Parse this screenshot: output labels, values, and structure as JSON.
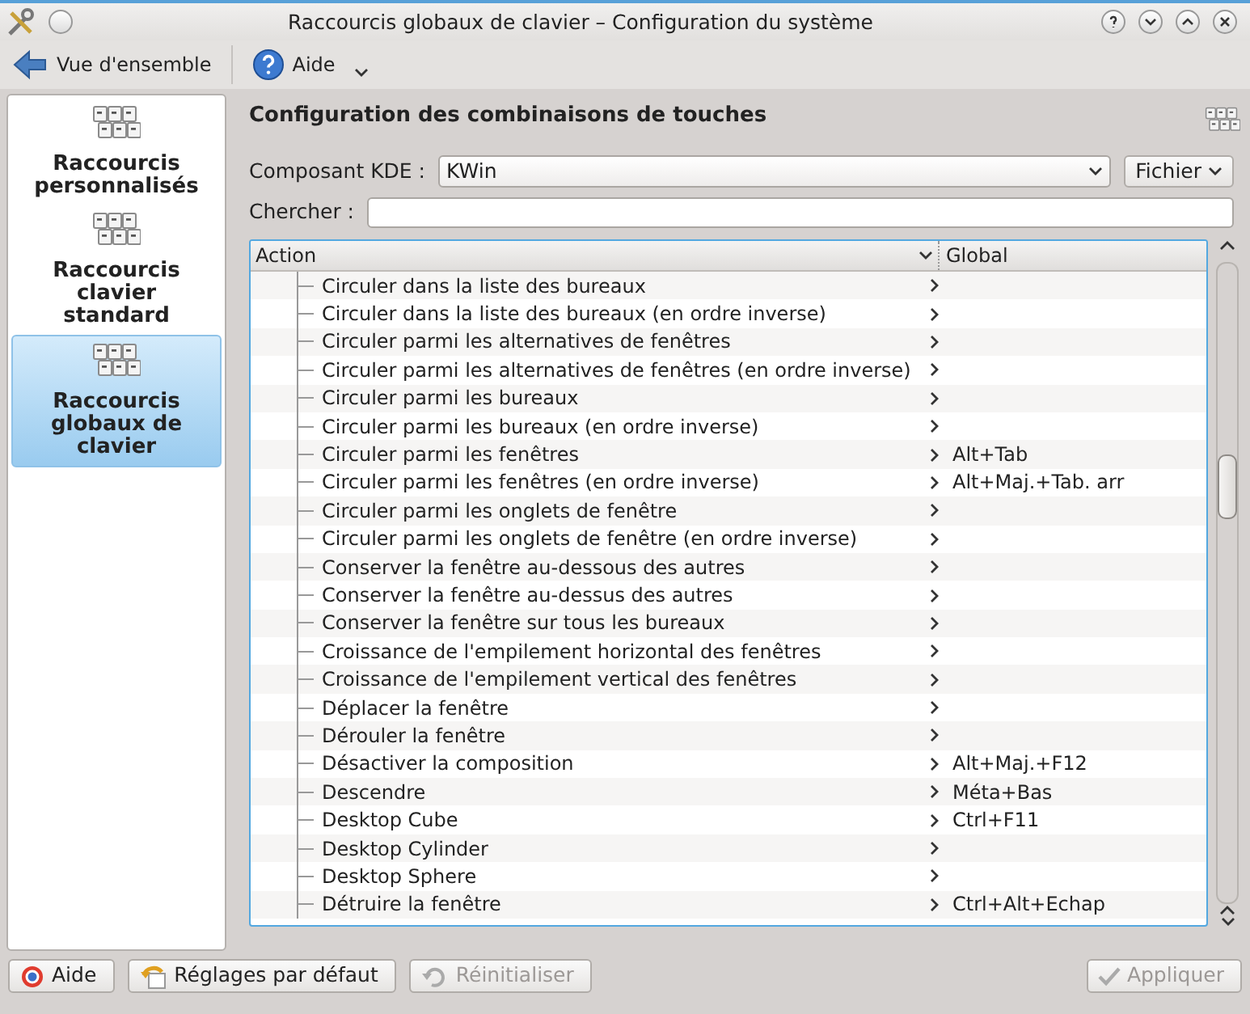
{
  "window": {
    "title": "Raccourcis globaux de clavier – Configuration du système"
  },
  "toolbar": [
    {
      "kind": "back",
      "label": "Vue d'ensemble"
    },
    {
      "kind": "help",
      "label": "Aide"
    }
  ],
  "sidebar": {
    "items": [
      {
        "label": "Raccourcis personnalisés",
        "selected": false
      },
      {
        "label": "Raccourcis clavier standard",
        "selected": false
      },
      {
        "label": "Raccourcis globaux de clavier",
        "selected": true
      }
    ]
  },
  "heading": "Configuration des combinaisons de touches",
  "component": {
    "label": "Composant KDE :",
    "value": "KWin",
    "file_button": "Fichier"
  },
  "search": {
    "label": "Chercher :"
  },
  "table": {
    "columns": [
      "Action",
      "Global"
    ],
    "rows": [
      {
        "action": "Circuler dans la liste des bureaux",
        "global": ""
      },
      {
        "action": "Circuler dans la liste des bureaux (en ordre inverse)",
        "global": ""
      },
      {
        "action": "Circuler parmi les alternatives de fenêtres",
        "global": ""
      },
      {
        "action": "Circuler parmi les alternatives de fenêtres (en ordre inverse)",
        "global": ""
      },
      {
        "action": "Circuler parmi les bureaux",
        "global": ""
      },
      {
        "action": "Circuler parmi les bureaux (en ordre inverse)",
        "global": ""
      },
      {
        "action": "Circuler parmi les fenêtres",
        "global": "Alt+Tab"
      },
      {
        "action": "Circuler parmi les fenêtres (en ordre inverse)",
        "global": "Alt+Maj.+Tab. arr"
      },
      {
        "action": "Circuler parmi les onglets de fenêtre",
        "global": ""
      },
      {
        "action": "Circuler parmi les onglets de fenêtre (en ordre inverse)",
        "global": ""
      },
      {
        "action": "Conserver la fenêtre au-dessous des autres",
        "global": ""
      },
      {
        "action": "Conserver la fenêtre au-dessus des autres",
        "global": ""
      },
      {
        "action": "Conserver la fenêtre sur tous les bureaux",
        "global": ""
      },
      {
        "action": "Croissance de l'empilement horizontal des fenêtres",
        "global": ""
      },
      {
        "action": "Croissance de l'empilement vertical des fenêtres",
        "global": ""
      },
      {
        "action": "Déplacer la fenêtre",
        "global": ""
      },
      {
        "action": "Dérouler la fenêtre",
        "global": ""
      },
      {
        "action": "Désactiver la composition",
        "global": "Alt+Maj.+F12"
      },
      {
        "action": "Descendre",
        "global": "Méta+Bas"
      },
      {
        "action": "Desktop Cube",
        "global": "Ctrl+F11"
      },
      {
        "action": "Desktop Cylinder",
        "global": ""
      },
      {
        "action": "Desktop Sphere",
        "global": ""
      },
      {
        "action": "Détruire la fenêtre",
        "global": "Ctrl+Alt+Echap"
      }
    ]
  },
  "buttons": [
    {
      "kind": "help",
      "label": "Aide",
      "disabled": false
    },
    {
      "kind": "defaults",
      "label": "Réglages par défaut",
      "disabled": false
    },
    {
      "kind": "reset",
      "label": "Réinitialiser",
      "disabled": true
    },
    {
      "kind": "apply",
      "label": "Appliquer",
      "disabled": true
    }
  ]
}
